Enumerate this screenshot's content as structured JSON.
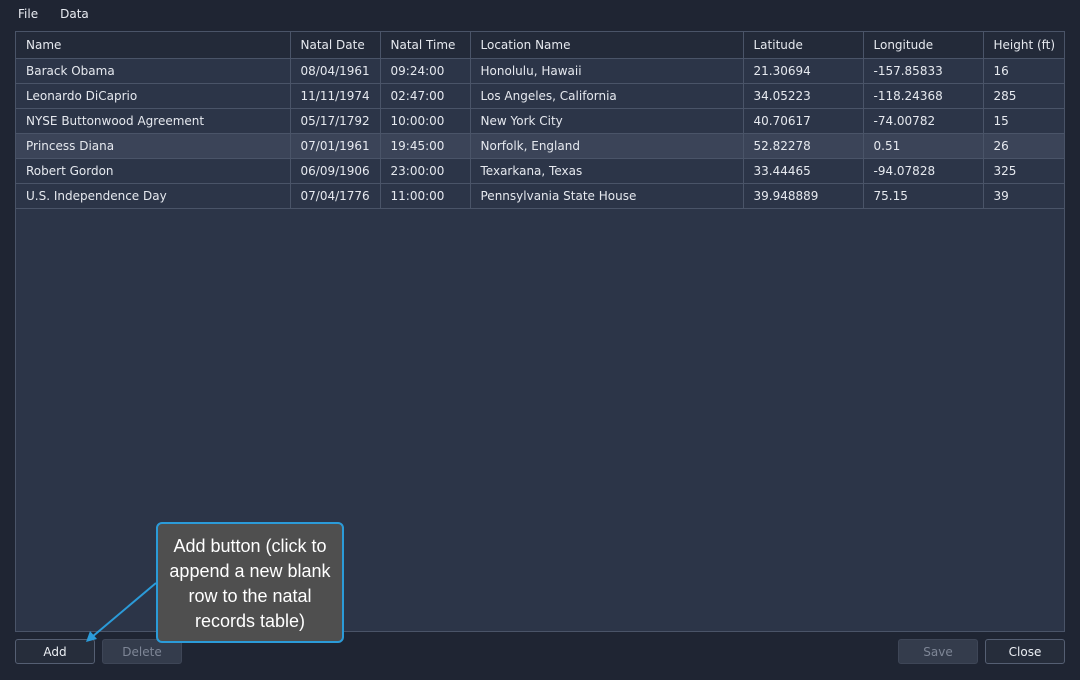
{
  "menu": {
    "file": "File",
    "data": "Data"
  },
  "table": {
    "columns": [
      "Name",
      "Natal Date",
      "Natal Time",
      "Location Name",
      "Latitude",
      "Longitude",
      "Height (ft)"
    ],
    "rows": [
      [
        "Barack Obama",
        "08/04/1961",
        "09:24:00",
        "Honolulu, Hawaii",
        "21.30694",
        "-157.85833",
        "16"
      ],
      [
        "Leonardo DiCaprio",
        "11/11/1974",
        "02:47:00",
        "Los Angeles, California",
        "34.05223",
        "-118.24368",
        "285"
      ],
      [
        "NYSE Buttonwood Agreement",
        "05/17/1792",
        "10:00:00",
        "New York City",
        "40.70617",
        "-74.00782",
        "15"
      ],
      [
        "Princess Diana",
        "07/01/1961",
        "19:45:00",
        "Norfolk, England",
        "52.82278",
        "0.51",
        "26"
      ],
      [
        "Robert Gordon",
        "06/09/1906",
        "23:00:00",
        "Texarkana, Texas",
        "33.44465",
        "-94.07828",
        "325"
      ],
      [
        "U.S. Independence Day",
        "07/04/1776",
        "11:00:00",
        "Pennsylvania State House",
        "39.948889",
        "75.15",
        "39"
      ]
    ],
    "selected_row": "Princess Diana"
  },
  "buttons": {
    "add": "Add",
    "delete": "Delete",
    "save": "Save",
    "close": "Close"
  },
  "callout": {
    "text": "Add button (click to append a new blank row to the natal records table)"
  },
  "colors": {
    "background": "#1f2533",
    "table_background": "#2c3548",
    "selected_row": "#3b4458",
    "callout_border": "#2b9bd9",
    "callout_fill": "#4f4f4f"
  }
}
